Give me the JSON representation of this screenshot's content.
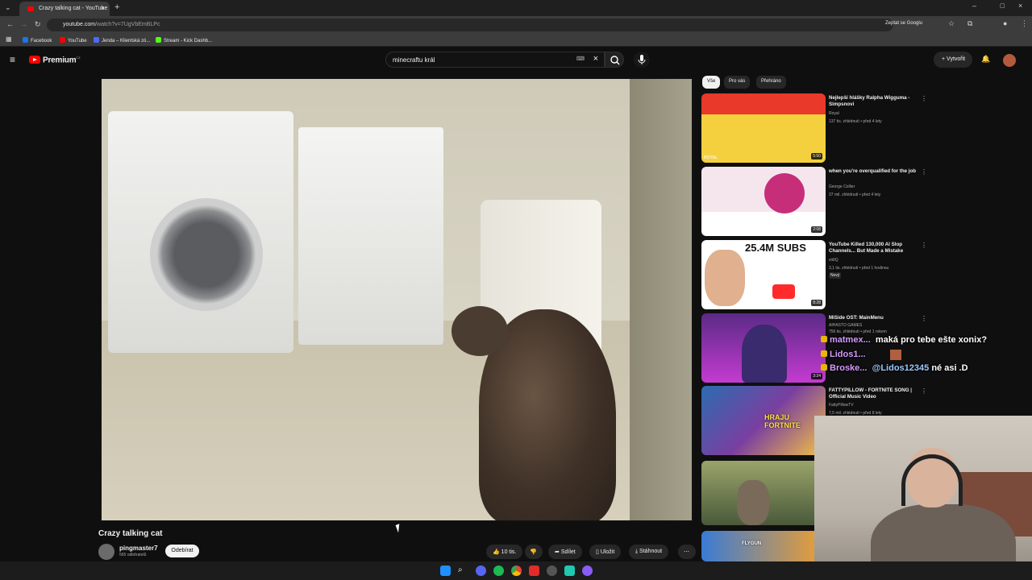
{
  "browser": {
    "tab_title": "Crazy talking cat - YouTube",
    "url_host": "youtube.com",
    "url_path": "/watch?v=7UgVbEmBLPc",
    "ask_google": "Zeptat se Googlu",
    "bookmarks": [
      {
        "label": "Facebook",
        "color": "#1877f2"
      },
      {
        "label": "YouTube",
        "color": "#ff0000"
      },
      {
        "label": "Jenda – Klientská zó...",
        "color": "#4a6cf7"
      },
      {
        "label": "Stream - Kick Dashb...",
        "color": "#53fc18"
      }
    ]
  },
  "youtube": {
    "brand": "Premium",
    "country": "CZ",
    "search_query": "minecraftu král",
    "create_label": "Vytvořit",
    "chips": [
      "Vše",
      "Pro vás",
      "Přehráno"
    ],
    "video": {
      "title": "Crazy talking cat",
      "channel": "pingmaster7",
      "subscribers": "565 odběratelů",
      "subscribe_label": "Odebírat",
      "likes": "10 tis.",
      "share_label": "Sdílet",
      "save_label": "Uložit",
      "download_label": "Stáhnout"
    },
    "recommendations": [
      {
        "title": "Nejlepší hlášky Ralpha Wigguma - Simpsnovi",
        "channel": "Royal",
        "meta": "137 tis. zhlédnutí • před 4 lety",
        "duration": "5:50",
        "thumb_colors": [
          "#e8392a",
          "#f4d03f"
        ],
        "thumb_text": "ROYAL"
      },
      {
        "title": "when you're overqualified for the job",
        "channel": "George Collier",
        "meta": "37 mil. zhlédnutí • před 4 lety",
        "duration": "2:08",
        "thumb_colors": [
          "#f5e6ee",
          "#c72e7a"
        ],
        "thumb_text": ""
      },
      {
        "title": "YouTube Killed 130,000 AI Slop Channels... But Made a Mistake",
        "channel": "vidIQ",
        "meta": "3,1 tis. zhlédnutí • před 1 hodinou",
        "duration": "8:28",
        "badge": "Nový",
        "thumb_colors": [
          "#ffffff",
          "#ff2b2b"
        ],
        "thumb_text": "25.4M SUBS"
      },
      {
        "title": "MiSide OST: MainMenu",
        "channel": "AIHASTO GAMES",
        "meta": "756 tis. zhlédnutí • před 1 rokem",
        "duration": "3:24",
        "thumb_colors": [
          "#5b2a86",
          "#c43bd1"
        ],
        "thumb_text": ""
      },
      {
        "title": "FATTYPILLOW - FORTNITE SONG | Official Music Video",
        "channel": "FattyPillowTV",
        "meta": "7,5 mil. zhlédnutí • před 8 lety",
        "duration": "",
        "thumb_colors": [
          "#2b6cb0",
          "#f6c343"
        ],
        "thumb_text": "HRAJU FORTNITE"
      },
      {
        "title": "",
        "channel": "",
        "meta": "",
        "duration": "",
        "thumb_colors": [
          "#4a5a3a",
          "#9aa36a"
        ],
        "thumb_text": ""
      },
      {
        "title": "",
        "channel": "",
        "meta": "",
        "duration": "",
        "thumb_colors": [
          "#3a7bd5",
          "#f0a030"
        ],
        "thumb_text": "FLYGUN"
      }
    ]
  },
  "chat": [
    {
      "name": "matmex...",
      "message": "maká pro tebe ešte xonix?"
    },
    {
      "name": "Lidos1...",
      "message": ""
    },
    {
      "name": "Broske...",
      "mention": "@Lidos12345",
      "message": "né asi .D"
    }
  ]
}
